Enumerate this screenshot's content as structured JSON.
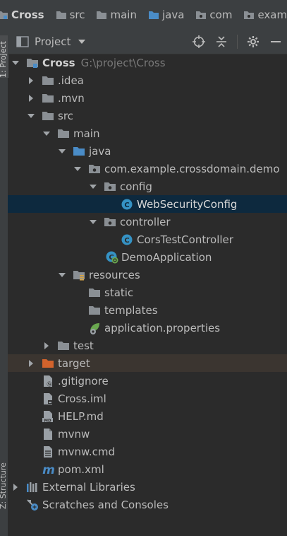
{
  "breadcrumb": {
    "items": [
      {
        "label": "Cross"
      },
      {
        "label": "src"
      },
      {
        "label": "main"
      },
      {
        "label": "java"
      },
      {
        "label": "com"
      },
      {
        "label": "exam"
      }
    ]
  },
  "side_tabs": {
    "project": "1: Project",
    "structure": "Z: Structure"
  },
  "panel": {
    "title": "Project"
  },
  "tree": {
    "root_label": "Cross",
    "root_path": "G:\\project\\Cross",
    "items": [
      {
        "label": ".idea"
      },
      {
        "label": ".mvn"
      },
      {
        "label": "src"
      },
      {
        "label": "main"
      },
      {
        "label": "java"
      },
      {
        "label": "com.example.crossdomain.demo"
      },
      {
        "label": "config"
      },
      {
        "label": "WebSecurityConfig"
      },
      {
        "label": "controller"
      },
      {
        "label": "CorsTestController"
      },
      {
        "label": "DemoApplication"
      },
      {
        "label": "resources"
      },
      {
        "label": "static"
      },
      {
        "label": "templates"
      },
      {
        "label": "application.properties"
      },
      {
        "label": "test"
      },
      {
        "label": "target"
      },
      {
        "label": ".gitignore"
      },
      {
        "label": "Cross.iml"
      },
      {
        "label": "HELP.md"
      },
      {
        "label": "mvnw"
      },
      {
        "label": "mvnw.cmd"
      },
      {
        "label": "pom.xml"
      },
      {
        "label": "External Libraries"
      },
      {
        "label": "Scratches and Consoles"
      }
    ]
  },
  "colors": {
    "background": "#2b2b2b",
    "toolbar": "#3c3f41",
    "selection": "#0d293e",
    "excluded": "#3b3530",
    "folder": "#8a8f94",
    "source_folder": "#4a8cc7",
    "excluded_folder": "#d3632c"
  }
}
